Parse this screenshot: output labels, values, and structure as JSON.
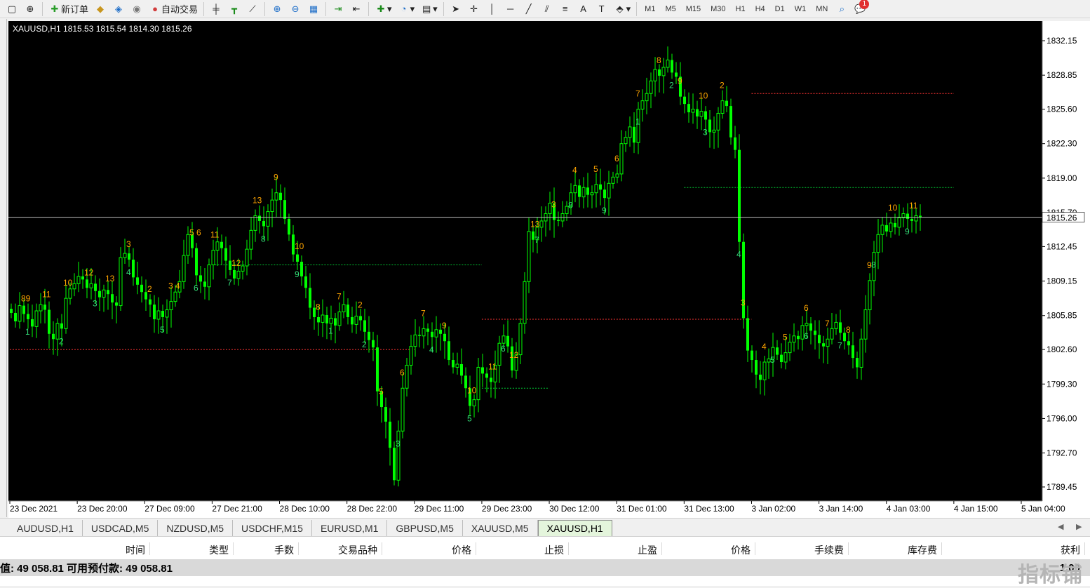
{
  "toolbar": {
    "new_order": "新订单",
    "auto_trade": "自动交易",
    "timeframes": [
      "M1",
      "M5",
      "M15",
      "M30",
      "H1",
      "H4",
      "D1",
      "W1",
      "MN"
    ],
    "notification_count": "1"
  },
  "chart": {
    "header": "XAUUSD,H1  1815.53 1815.54 1814.30 1815.26",
    "current_price_label": "1815.26",
    "price_label_partial": "1815.70"
  },
  "chart_data": {
    "type": "candlestick",
    "symbol": "XAUUSD",
    "timeframe": "H1",
    "ohlc_last": {
      "open": 1815.53,
      "high": 1815.54,
      "low": 1814.3,
      "close": 1815.26
    },
    "y_ticks": [
      1832.15,
      1828.85,
      1825.6,
      1822.3,
      1819.0,
      1815.7,
      1812.45,
      1809.15,
      1805.85,
      1802.6,
      1799.3,
      1796.0,
      1792.7,
      1789.45
    ],
    "x_ticks": [
      "23 Dec 2021",
      "23 Dec 20:00",
      "27 Dec 09:00",
      "27 Dec 21:00",
      "28 Dec 10:00",
      "28 Dec 22:00",
      "29 Dec 11:00",
      "29 Dec 23:00",
      "30 Dec 12:00",
      "31 Dec 01:00",
      "31 Dec 13:00",
      "3 Jan 02:00",
      "3 Jan 14:00",
      "4 Jan 03:00",
      "4 Jan 15:00",
      "5 Jan 04:00"
    ],
    "current_price": 1815.26,
    "colors": {
      "background": "#000000",
      "candle": "#00ff00",
      "count_orange": "#ffa500",
      "count_green": "#33dd77",
      "resistance": "#ff3333",
      "support": "#00cc33"
    },
    "grid": false,
    "candle_path_closes": [
      1806.1,
      1805.3,
      1806.8,
      1806.0,
      1805.5,
      1804.8,
      1806.3,
      1806.9,
      1806.4,
      1804.1,
      1803.6,
      1805.1,
      1804.6,
      1807.5,
      1808.4,
      1808.9,
      1809.6,
      1809.3,
      1808.5,
      1808.9,
      1808.2,
      1807.6,
      1808.3,
      1807.9,
      1807.1,
      1806.8,
      1811.4,
      1811.8,
      1811.2,
      1809.5,
      1808.8,
      1808.1,
      1807.4,
      1806.9,
      1805.5,
      1806.3,
      1805.7,
      1806.4,
      1807.2,
      1808.1,
      1809.1,
      1811.6,
      1813.6,
      1812.3,
      1809.7,
      1809.1,
      1808.6,
      1810.7,
      1812.1,
      1812.9,
      1812.3,
      1811.1,
      1810.2,
      1809.4,
      1810.1,
      1810.6,
      1812.2,
      1814.0,
      1815.4,
      1814.9,
      1814.4,
      1815.8,
      1816.9,
      1817.6,
      1816.9,
      1815.1,
      1813.6,
      1811.7,
      1811.0,
      1809.6,
      1808.5,
      1806.6,
      1805.7,
      1805.2,
      1805.9,
      1805.1,
      1805.6,
      1804.9,
      1806.2,
      1806.9,
      1805.7,
      1805.0,
      1805.8,
      1805.4,
      1804.3,
      1803.5,
      1802.8,
      1798.6,
      1797.1,
      1795.7,
      1793.2,
      1790.1,
      1794.8,
      1798.9,
      1801.1,
      1802.9,
      1804.0,
      1803.9,
      1804.6,
      1804.3,
      1803.8,
      1804.5,
      1804.1,
      1803.4,
      1801.6,
      1800.9,
      1801.2,
      1800.1,
      1798.9,
      1797.2,
      1797.8,
      1800.9,
      1800.3,
      1799.9,
      1799.5,
      1801.1,
      1803.2,
      1803.9,
      1802.9,
      1800.6,
      1802.1,
      1805.1,
      1809.1,
      1813.9,
      1813.1,
      1814.3,
      1814.9,
      1815.6,
      1816.6,
      1815.0,
      1814.9,
      1815.6,
      1816.3,
      1817.6,
      1818.3,
      1817.2,
      1818.1,
      1817.4,
      1817.6,
      1818.4,
      1817.9,
      1817.1,
      1818.5,
      1819.1,
      1819.4,
      1822.3,
      1822.9,
      1823.9,
      1822.4,
      1825.6,
      1826.4,
      1827.1,
      1828.3,
      1829.4,
      1828.8,
      1829.6,
      1830.3,
      1829.1,
      1828.7,
      1826.8,
      1826.1,
      1825.3,
      1825.6,
      1824.9,
      1825.4,
      1824.6,
      1823.4,
      1823.6,
      1825.2,
      1826.4,
      1825.9,
      1822.9,
      1821.7,
      1812.9,
      1805.6,
      1802.5,
      1801.6,
      1800.2,
      1799.7,
      1801.4,
      1801.7,
      1802.8,
      1802.1,
      1801.4,
      1802.3,
      1803.3,
      1803.9,
      1803.6,
      1804.9,
      1805.1,
      1804.4,
      1804.0,
      1803.2,
      1802.9,
      1803.6,
      1804.6,
      1805.2,
      1804.2,
      1803.4,
      1803.0,
      1801.8,
      1800.9,
      1803.6,
      1806.4,
      1809.2,
      1811.9,
      1813.6,
      1814.5,
      1813.9,
      1814.7,
      1814.3,
      1815.2,
      1815.6,
      1815.1,
      1814.9,
      1815.4,
      1815.26
    ],
    "annotations_orange": [
      "89",
      "11",
      "10",
      "12",
      "13",
      "3",
      "2",
      "3 4",
      "5 6",
      "11",
      "12",
      "13",
      "9",
      "10",
      "8",
      "7",
      "2",
      "5",
      "6",
      "7",
      "9",
      "10",
      "11",
      "12",
      "13",
      "3",
      "4",
      "5",
      "6",
      "7",
      "8",
      "9",
      "10",
      "2",
      "3",
      "4",
      "5",
      "6",
      "7",
      "8",
      "9",
      "10",
      "11"
    ],
    "annotations_green": [
      "1",
      "2",
      "3",
      "4",
      "5",
      "6",
      "7",
      "8",
      "9",
      "1",
      "2",
      "3",
      "4",
      "5",
      "6",
      "7",
      "8",
      "9",
      "1",
      "2",
      "3",
      "4",
      "5",
      "6",
      "7",
      "8",
      "9"
    ],
    "setup_lines": [
      {
        "type": "resistance",
        "from": "23 Dec 2021",
        "to": "29 Dec 11:00",
        "price": 1802.6
      },
      {
        "type": "support",
        "from": "27 Dec 21:00",
        "to": "29 Dec 23:00",
        "price": 1810.7
      },
      {
        "type": "resistance",
        "from": "29 Dec 23:00",
        "to": "3 Jan 02:00",
        "price": 1805.5
      },
      {
        "type": "support",
        "from": "29 Dec 23:00",
        "to": "30 Dec 12:00",
        "price": 1798.9
      },
      {
        "type": "support",
        "from": "31 Dec 13:00",
        "to": "4 Jan 15:00",
        "price": 1818.1
      },
      {
        "type": "resistance",
        "from": "3 Jan 02:00",
        "to": "4 Jan 15:00",
        "price": 1827.1
      }
    ]
  },
  "tabs": [
    "AUDUSD,H1",
    "USDCAD,M5",
    "NZDUSD,M5",
    "USDCHF,M15",
    "EURUSD,M1",
    "GBPUSD,M5",
    "XAUUSD,M5",
    "XAUUSD,H1"
  ],
  "active_tab": "XAUUSD,H1",
  "terminal": {
    "headers": [
      "时间",
      "类型",
      "手数",
      "交易品种",
      "价格",
      "止损",
      "止盈",
      "价格",
      "手续费",
      "库存费",
      "获利"
    ],
    "balance_line": "值: 49 058.81  可用预付款: 49 058.81",
    "profit_partial": "1.00"
  },
  "watermark": "指标铺"
}
